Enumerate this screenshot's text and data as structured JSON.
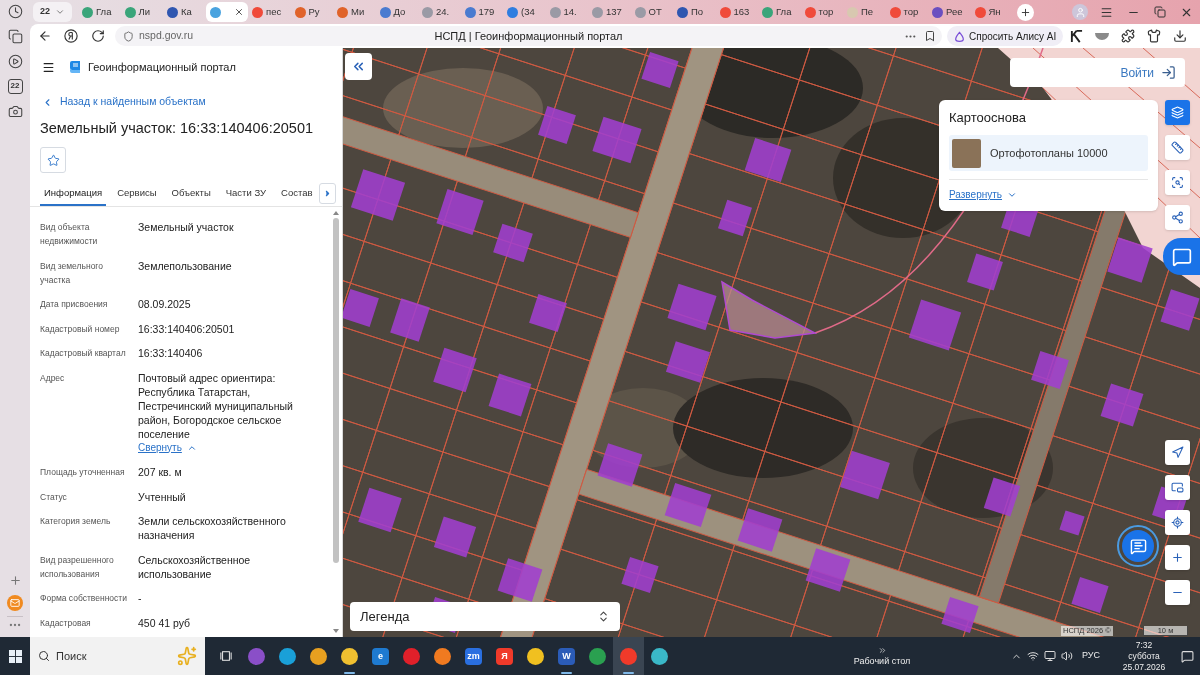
{
  "browser_sidebar": {
    "calendar_day": "22"
  },
  "tab_strip": {
    "tab_count": "22",
    "tabs": [
      {
        "label": "Гла",
        "color": "#3aa57a",
        "selected": false
      },
      {
        "label": "Ли",
        "color": "#3aa57a",
        "selected": false
      },
      {
        "label": "Ка",
        "color": "#2f56b0",
        "selected": false
      },
      {
        "color": "#4aa3df",
        "selected": true
      },
      {
        "label": "пес",
        "color": "#f04a3a",
        "selected": false
      },
      {
        "label": "Ру",
        "color": "#e0632a",
        "selected": false
      },
      {
        "label": "Ми",
        "color": "#e0632a",
        "selected": false
      },
      {
        "label": "До",
        "color": "#4a7bd0",
        "selected": false
      },
      {
        "label": "24.",
        "color": "#9a9aa5",
        "selected": false
      },
      {
        "label": "179",
        "color": "#4a7bd0",
        "selected": false
      },
      {
        "label": "(34",
        "color": "#2f7de0",
        "selected": false
      },
      {
        "label": "14.",
        "color": "#9a9aa5",
        "selected": false
      },
      {
        "label": "137",
        "color": "#9a9aa5",
        "selected": false
      },
      {
        "label": "ОТ",
        "color": "#9a9aa5",
        "selected": false
      },
      {
        "label": "По",
        "color": "#2f56b0",
        "selected": false
      },
      {
        "label": "163",
        "color": "#f04a3a",
        "selected": false
      },
      {
        "label": "Гла",
        "color": "#3aa57a",
        "selected": false
      },
      {
        "label": "тор",
        "color": "#f04a3a",
        "selected": false
      },
      {
        "label": "Пе",
        "color": "#d8c8b0",
        "selected": false
      },
      {
        "label": "тор",
        "color": "#f04a3a",
        "selected": false
      },
      {
        "label": "Рее",
        "color": "#6a4fc0",
        "selected": false
      },
      {
        "label": "Ян",
        "color": "#f04a3a",
        "selected": false
      }
    ]
  },
  "address_bar": {
    "url": "nspd.gov.ru",
    "page_title": "НСПД | Геоинформационный портал",
    "alice_button": "Спросить Алису AI"
  },
  "portal": {
    "app_title": "Геоинформационный портал",
    "back_link": "Назад к найденным объектам",
    "object_title": "Земельный участок: 16:33:140406:20501",
    "favorite": false,
    "tabs": [
      {
        "label": "Информация",
        "selected": true
      },
      {
        "label": "Сервисы",
        "selected": false
      },
      {
        "label": "Объекты",
        "selected": false
      },
      {
        "label": "Части ЗУ",
        "selected": false
      },
      {
        "label": "Состав",
        "selected": false
      }
    ],
    "properties": [
      {
        "label": "Вид объекта недвижимости",
        "value": "Земельный участок"
      },
      {
        "label": "Вид земельного участка",
        "value": "Землепользование"
      },
      {
        "label": "Дата присвоения",
        "value": "08.09.2025"
      },
      {
        "label": "Кадастровый номер",
        "value": "16:33:140406:20501"
      },
      {
        "label": "Кадастровый квартал",
        "value": "16:33:140406"
      },
      {
        "label": "Адрес",
        "value": "Почтовый адрес ориентира: Республика Татарстан, Пестречинский муниципальный район, Богородское сельское поселение",
        "toggle": {
          "label": "Свернуть",
          "expanded": true
        }
      },
      {
        "label": "Площадь уточненная",
        "value": "207 кв. м"
      },
      {
        "label": "Статус",
        "value": "Учтенный"
      },
      {
        "label": "Категория земель",
        "value": "Земли сельскохозяйственного назначения"
      },
      {
        "label": "Вид разрешенного использования",
        "value": "Сельскохозяйственное использование"
      },
      {
        "label": "Форма собственности",
        "value": "-"
      },
      {
        "label": "Кадастровая",
        "value": "450 41 руб"
      }
    ]
  },
  "map": {
    "login_button": "Войти",
    "basemap": {
      "title": "Картооснова",
      "layers": [
        {
          "label": "Ортофотопланы 10000",
          "selected": true
        }
      ],
      "expand_link": "Развернуть"
    },
    "tools": [
      {
        "kind": "layers",
        "selected": true
      },
      {
        "kind": "ruler",
        "selected": false
      },
      {
        "kind": "select",
        "selected": false
      },
      {
        "kind": "share",
        "selected": false
      }
    ],
    "legend_select": "Легенда",
    "attribution": "НСПД 2026 ©",
    "scale": "10 м"
  },
  "taskbar": {
    "search_placeholder": "Поиск",
    "apps": [
      {
        "color": "#8a4fc8",
        "selected": false,
        "running": false
      },
      {
        "color": "#1aa0d8",
        "selected": false,
        "running": false
      },
      {
        "color": "#e8a020",
        "selected": false,
        "running": false
      },
      {
        "color": "#f0c030",
        "selected": false,
        "running": true
      },
      {
        "color": "#1e7ad0",
        "glyph": "e",
        "selected": false,
        "running": false
      },
      {
        "color": "#e0202a",
        "selected": false,
        "running": false
      },
      {
        "color": "#f07a20",
        "selected": false,
        "running": false
      },
      {
        "color": "#2a6fe0",
        "glyph": "zm",
        "selected": false,
        "running": false
      },
      {
        "color": "#f03a2a",
        "glyph": "Я",
        "selected": false,
        "running": false
      },
      {
        "color": "#f0c020",
        "selected": false,
        "running": false
      },
      {
        "color": "#2b5cb8",
        "glyph": "W",
        "selected": false,
        "running": true
      },
      {
        "color": "#2aa050",
        "selected": false,
        "running": false
      },
      {
        "color": "#f03a2a",
        "selected": true,
        "running": true
      },
      {
        "color": "#3ab8c8",
        "selected": false,
        "running": false
      }
    ],
    "desktop_label": "Рабочий стол",
    "language": "РУС",
    "time": "7:32",
    "weekday": "суббота",
    "date": "25.07.2026"
  }
}
